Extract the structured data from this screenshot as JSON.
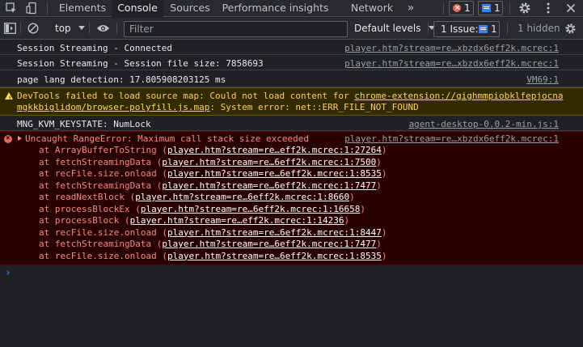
{
  "tabs": {
    "elements": "Elements",
    "console": "Console",
    "sources": "Sources",
    "performance": "Performance insights",
    "network": "Network",
    "more": "»",
    "error_count": "1",
    "message_count": "1"
  },
  "toolbar": {
    "context": "top",
    "filter_placeholder": "Filter",
    "levels": "Default levels",
    "issues_label": "1 Issue:",
    "issues_count": "1",
    "hidden": "1 hidden"
  },
  "messages": [
    {
      "text": "Session Streaming - Connected",
      "source": "player.htm?stream=re…xbzdx6eff2k.mcrec:1"
    },
    {
      "text": "Session Streaming - Session file size: 7858693",
      "source": "player.htm?stream=re…xbzdx6eff2k.mcrec:1"
    },
    {
      "text": "page lang detection: 17.805908203125 ms",
      "source": "VM69:1"
    }
  ],
  "warning": {
    "prefix": "DevTools failed to load source map: Could not load content for ",
    "link_line1": "chrome-extension://gighmmpiobklfepjocna",
    "link_line2": "mgkkbiglidom/browser-polyfill.js.map",
    "suffix": ": System error: net::ERR_FILE_NOT_FOUND"
  },
  "keystate": {
    "text": "MNG_KVM_KEYSTATE: NumLock",
    "source": "agent-desktop-0.0.2-min.js:1"
  },
  "error": {
    "title": "Uncaught RangeError: Maximum call stack size exceeded",
    "source": "player.htm?stream=re…xbzdx6eff2k.mcrec:1",
    "frames": [
      {
        "fn": "at ArrayBufferToString",
        "loc": "player.htm?stream=re…eff2k.mcrec:1:27264"
      },
      {
        "fn": "at fetchStreamingData",
        "loc": "player.htm?stream=re…6eff2k.mcrec:1:7500"
      },
      {
        "fn": "at recFile.size.onload",
        "loc": "player.htm?stream=re…6eff2k.mcrec:1:8535"
      },
      {
        "fn": "at fetchStreamingData",
        "loc": "player.htm?stream=re…6eff2k.mcrec:1:7477"
      },
      {
        "fn": "at readNextBlock",
        "loc": "player.htm?stream=re…6eff2k.mcrec:1:8660"
      },
      {
        "fn": "at processBlockEx",
        "loc": "player.htm?stream=re…6eff2k.mcrec:1:16658"
      },
      {
        "fn": "at processBlock",
        "loc": "player.htm?stream=re…eff2k.mcrec:1:14236"
      },
      {
        "fn": "at recFile.size.onload",
        "loc": "player.htm?stream=re…6eff2k.mcrec:1:8447"
      },
      {
        "fn": "at fetchStreamingData",
        "loc": "player.htm?stream=re…6eff2k.mcrec:1:7477"
      },
      {
        "fn": "at recFile.size.onload",
        "loc": "player.htm?stream=re…6eff2k.mcrec:1:8535"
      }
    ]
  },
  "prompt": "›",
  "colors": {
    "error": "#f28b82",
    "warning": "#fdd663",
    "accent": "#3c82f6"
  }
}
